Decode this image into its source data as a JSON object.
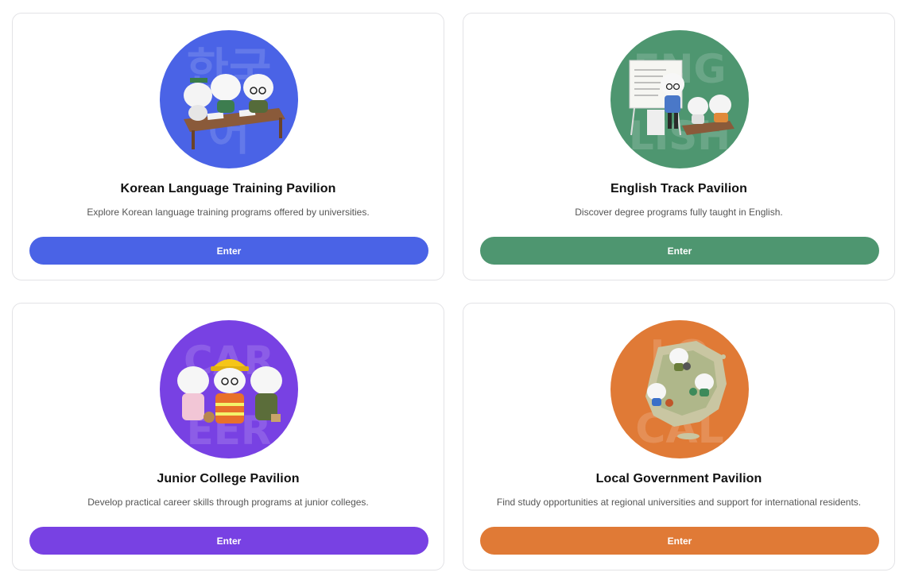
{
  "pavilions": [
    {
      "title": "Korean Language Training Pavilion",
      "description": "Explore Korean language training programs offered by universities.",
      "button_label": "Enter",
      "color": "#4a63e6",
      "bg_text": [
        "한국",
        "어"
      ],
      "icon": "classroom-illustration"
    },
    {
      "title": "English Track Pavilion",
      "description": "Discover degree programs fully taught in English.",
      "button_label": "Enter",
      "color": "#4e9670",
      "bg_text": [
        "ENG",
        "LISH"
      ],
      "icon": "teacher-whiteboard-illustration"
    },
    {
      "title": "Junior College Pavilion",
      "description": "Develop practical career skills through programs at junior colleges.",
      "button_label": "Enter",
      "color": "#7841e3",
      "bg_text": [
        "CAR",
        "EER"
      ],
      "icon": "career-characters-illustration"
    },
    {
      "title": "Local Government Pavilion",
      "description": "Find study opportunities at regional universities and support for international residents.",
      "button_label": "Enter",
      "color": "#e07a36",
      "bg_text": [
        "LO",
        "CAL"
      ],
      "icon": "korea-map-illustration"
    }
  ]
}
